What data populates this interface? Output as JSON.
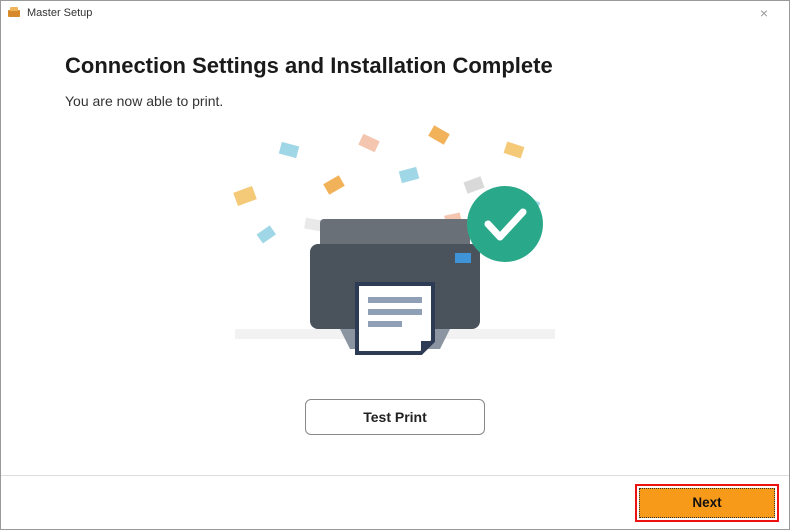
{
  "window": {
    "title": "Master Setup"
  },
  "content": {
    "heading": "Connection Settings and Installation Complete",
    "subheading": "You are now able to print.",
    "test_print_label": "Test Print"
  },
  "footer": {
    "next_label": "Next"
  },
  "colors": {
    "accent": "#f79a1a",
    "highlight_border": "#e11212",
    "check_circle": "#2aa98a"
  }
}
